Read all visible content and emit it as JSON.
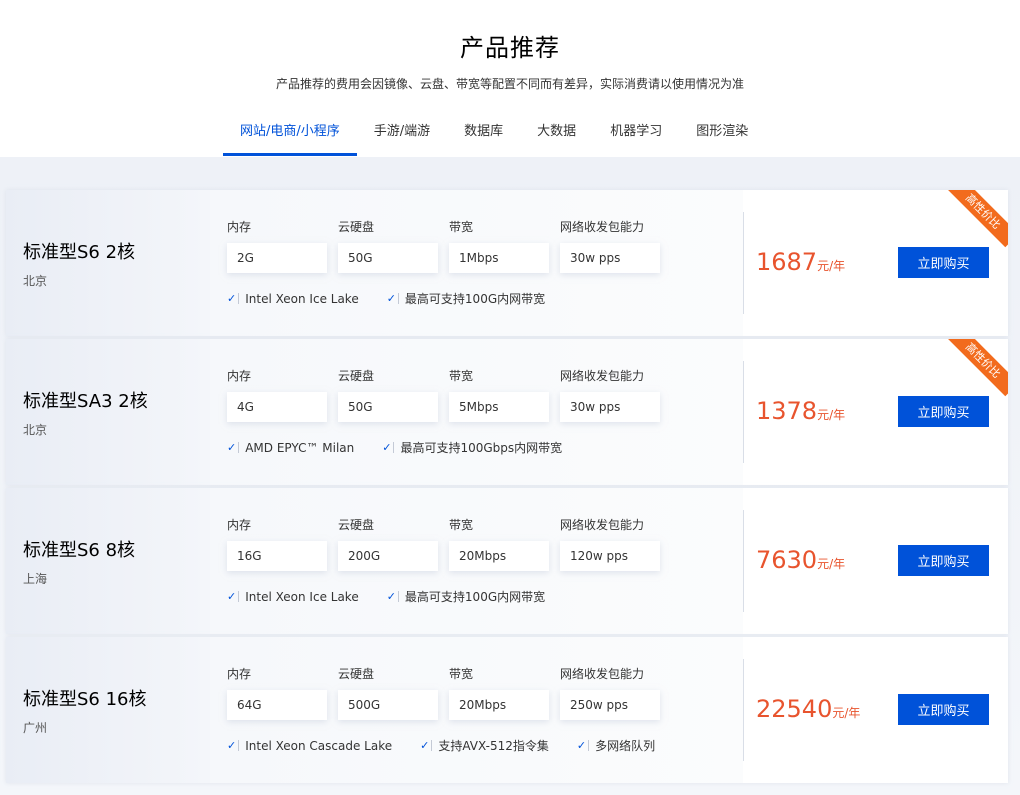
{
  "header": {
    "title": "产品推荐",
    "subtitle": "产品推荐的费用会因镜像、云盘、带宽等配置不同而有差异，实际消费请以使用情况为准"
  },
  "tabs": [
    {
      "label": "网站/电商/小程序",
      "active": true
    },
    {
      "label": "手游/端游",
      "active": false
    },
    {
      "label": "数据库",
      "active": false
    },
    {
      "label": "大数据",
      "active": false
    },
    {
      "label": "机器学习",
      "active": false
    },
    {
      "label": "图形渲染",
      "active": false
    }
  ],
  "spec_labels": {
    "memory": "内存",
    "disk": "云硬盘",
    "bandwidth": "带宽",
    "pps": "网络收发包能力"
  },
  "price_unit": "元/年",
  "buy_label": "立即购买",
  "check_icon": "✓",
  "colors": {
    "accent": "#0052d9",
    "price": "#e8542e",
    "ribbon": "#f26b1d"
  },
  "products": [
    {
      "name": "标准型S6 2核",
      "region": "北京",
      "memory": "2G",
      "disk": "50G",
      "bandwidth": "1Mbps",
      "pps": "30w pps",
      "features": [
        "Intel Xeon Ice Lake",
        "最高可支持100G内网带宽"
      ],
      "price": "1687",
      "ribbon": "高性价比"
    },
    {
      "name": "标准型SA3 2核",
      "region": "北京",
      "memory": "4G",
      "disk": "50G",
      "bandwidth": "5Mbps",
      "pps": "30w pps",
      "features": [
        "AMD EPYC™ Milan",
        "最高可支持100Gbps内网带宽"
      ],
      "price": "1378",
      "ribbon": "高性价比"
    },
    {
      "name": "标准型S6 8核",
      "region": "上海",
      "memory": "16G",
      "disk": "200G",
      "bandwidth": "20Mbps",
      "pps": "120w pps",
      "features": [
        "Intel Xeon Ice Lake",
        "最高可支持100G内网带宽"
      ],
      "price": "7630",
      "ribbon": ""
    },
    {
      "name": "标准型S6 16核",
      "region": "广州",
      "memory": "64G",
      "disk": "500G",
      "bandwidth": "20Mbps",
      "pps": "250w pps",
      "features": [
        "Intel Xeon Cascade Lake",
        "支持AVX-512指令集",
        "多网络队列"
      ],
      "price": "22540",
      "ribbon": ""
    }
  ]
}
